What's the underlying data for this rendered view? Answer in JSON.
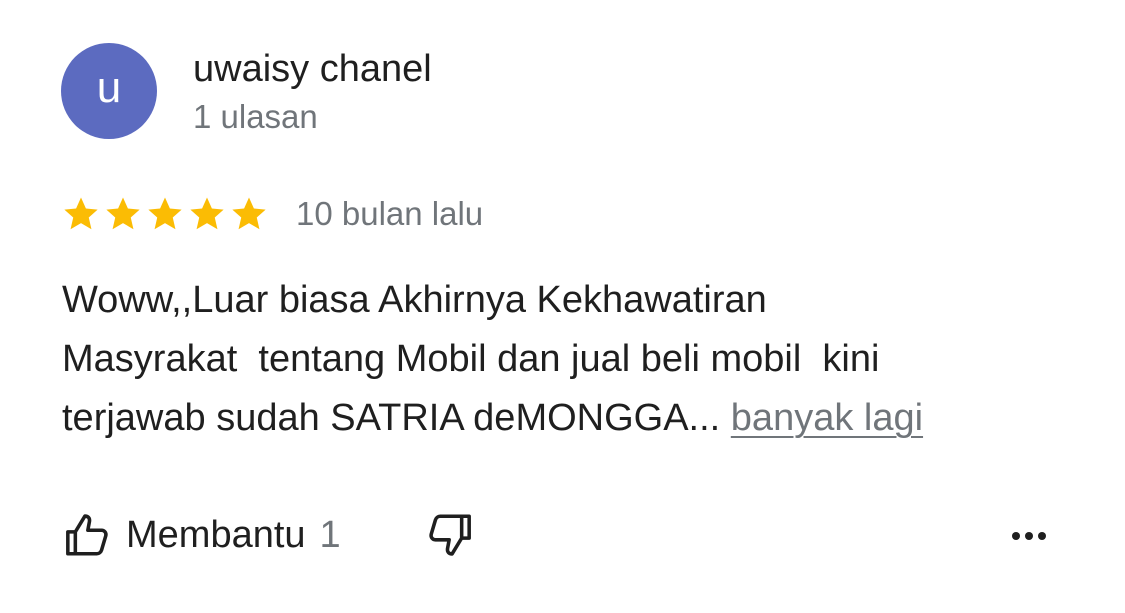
{
  "reviewer": {
    "avatar_initial": "u",
    "avatar_color": "#5c6bc0",
    "name": "uwaisy chanel",
    "review_count": "1 ulasan"
  },
  "rating": {
    "stars": 5,
    "max_stars": 5,
    "star_color": "#fbbc04",
    "time_ago": "10 bulan lalu"
  },
  "review": {
    "lines": [
      "Woww,,Luar biasa Akhirnya Kekhawatiran",
      "Masyrakat  tentang Mobil dan jual beli mobil  kini",
      "terjawab sudah SATRIA deMONGGA... "
    ],
    "more_link": "banyak lagi"
  },
  "actions": {
    "helpful_label": "Membantu",
    "helpful_count": "1",
    "helpful_icon": "thumb-up-outline-icon",
    "not_helpful_icon": "thumb-down-outline-icon",
    "more_icon": "more-horizontal-icon"
  },
  "colors": {
    "text_primary": "#1f1f1f",
    "text_secondary": "#70757a"
  }
}
